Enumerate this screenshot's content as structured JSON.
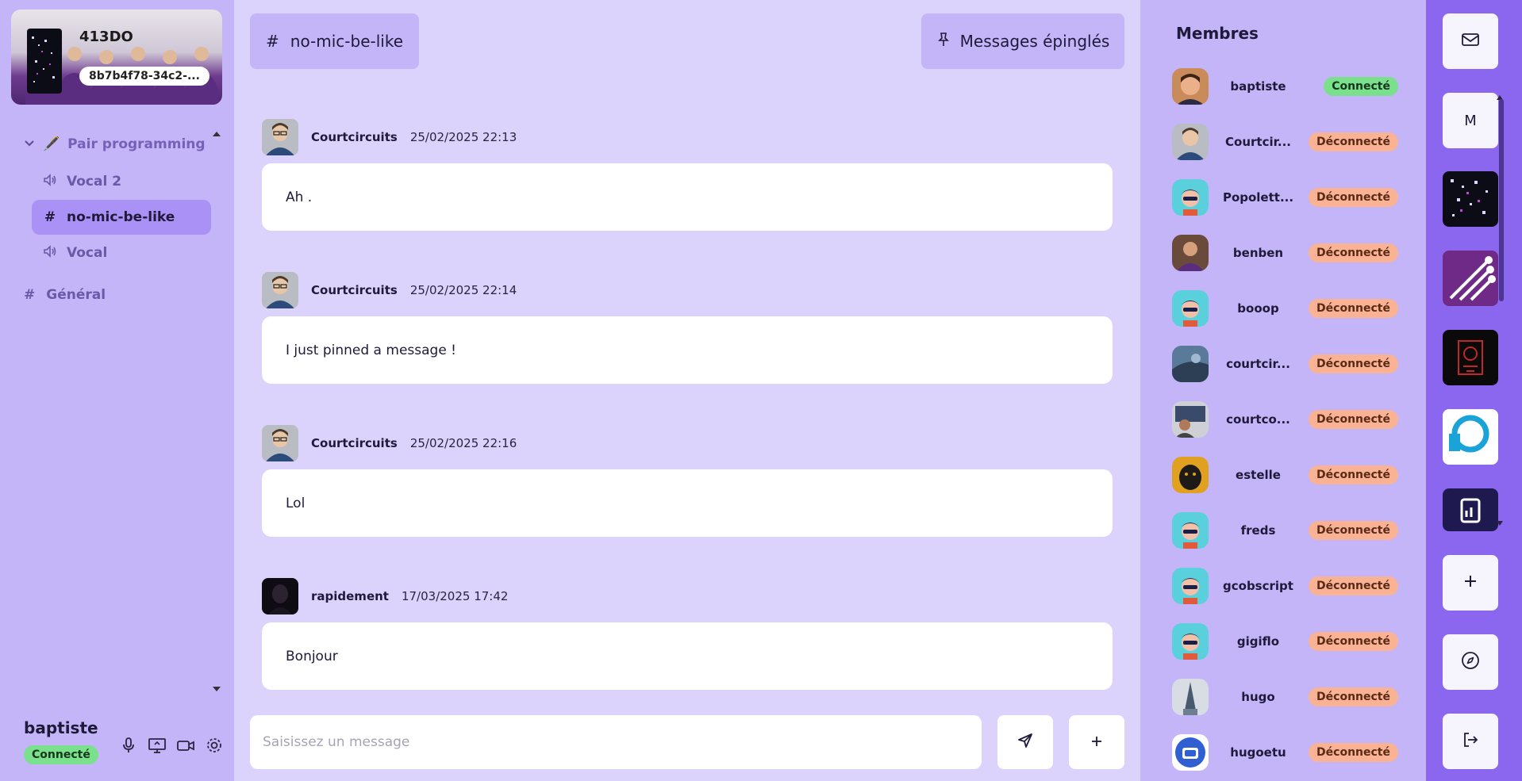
{
  "server": {
    "name": "413DO",
    "id_short": "8b7b4f78-34c2-..."
  },
  "sidebar": {
    "category": {
      "label": "Pair programming",
      "emoji": "🖋️"
    },
    "channels": [
      {
        "name": "Vocal 2",
        "type": "voice"
      },
      {
        "name": "no-mic-be-like",
        "type": "text"
      },
      {
        "name": "Vocal",
        "type": "voice"
      }
    ],
    "general": "Général"
  },
  "user": {
    "name": "baptiste",
    "status": "Connecté"
  },
  "chat": {
    "channel_name": "no-mic-be-like",
    "pinned_label": "Messages épinglés",
    "messages": [
      {
        "author": "Courtcircuits",
        "time": "25/02/2025 22:13",
        "text": "Ah ."
      },
      {
        "author": "Courtcircuits",
        "time": "25/02/2025 22:14",
        "text": "I just pinned a message !"
      },
      {
        "author": "Courtcircuits",
        "time": "25/02/2025 22:16",
        "text": "Lol"
      },
      {
        "author": "rapidement",
        "time": "17/03/2025 17:42",
        "text": "Bonjour"
      }
    ],
    "composer_placeholder": "Saisissez un message"
  },
  "members": {
    "title": "Membres",
    "list": [
      {
        "name": "baptiste",
        "status": "Connecté"
      },
      {
        "name": "Courtcir...",
        "status": "Déconnecté"
      },
      {
        "name": "Popolett...",
        "status": "Déconnecté"
      },
      {
        "name": "benben",
        "status": "Déconnecté"
      },
      {
        "name": "booop",
        "status": "Déconnecté"
      },
      {
        "name": "courtcir...",
        "status": "Déconnecté"
      },
      {
        "name": "courtco...",
        "status": "Déconnecté"
      },
      {
        "name": "estelle",
        "status": "Déconnecté"
      },
      {
        "name": "freds",
        "status": "Déconnecté"
      },
      {
        "name": "gcobscript",
        "status": "Déconnecté"
      },
      {
        "name": "gigiflo",
        "status": "Déconnecté"
      },
      {
        "name": "hugo",
        "status": "Déconnecté"
      },
      {
        "name": "hugoetu",
        "status": "Déconnecté"
      }
    ]
  },
  "rail": {
    "dm_letter": "M"
  },
  "colors": {
    "accent": "#8b67f0",
    "online": "#7be08c",
    "offline": "#f9b394"
  }
}
